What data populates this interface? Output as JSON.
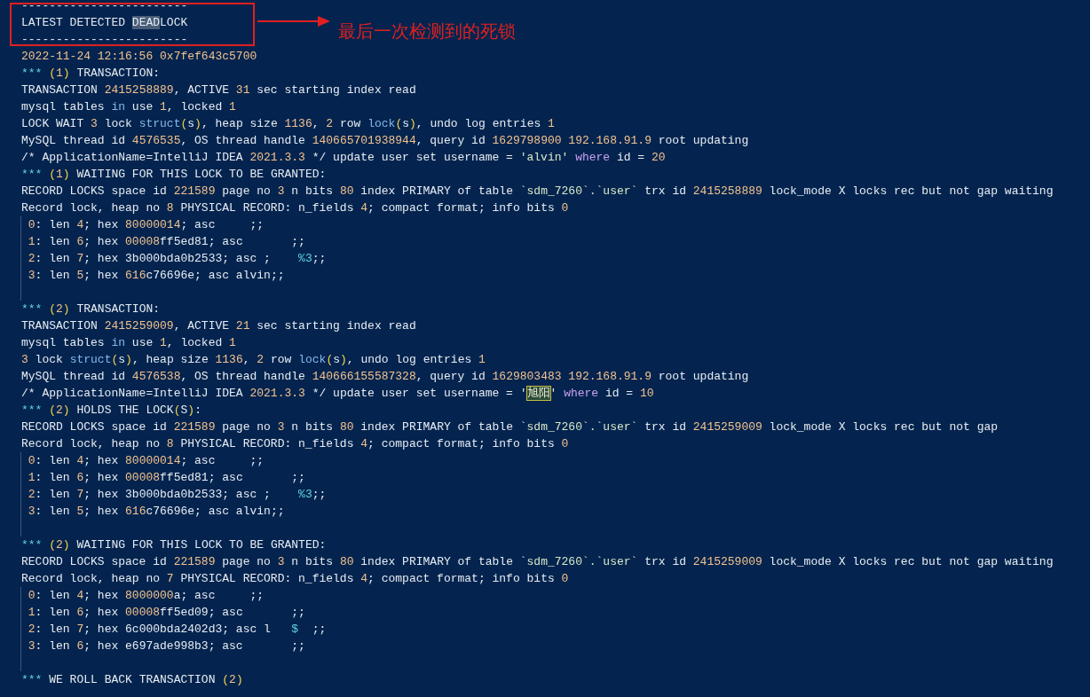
{
  "annotation": {
    "label": "最后一次检测到的死锁"
  },
  "lines": [
    {
      "kind": "code",
      "tokens": [
        {
          "text": "------------------------",
          "kind": "plain"
        }
      ]
    },
    {
      "kind": "code",
      "tokens": [
        {
          "text": "LATEST DETECTED ",
          "kind": "plain"
        },
        {
          "text": "DEAD",
          "kind": "mark"
        },
        {
          "text": "LOCK",
          "kind": "plain"
        }
      ]
    },
    {
      "kind": "code",
      "tokens": [
        {
          "text": "------------------------",
          "kind": "plain"
        }
      ]
    },
    {
      "kind": "code",
      "tokens": [
        {
          "text": "2022-11-24 12:16:56 0x7fef643c5700",
          "kind": "num"
        }
      ]
    },
    {
      "kind": "code",
      "tokens": [
        {
          "text": "*** ",
          "kind": "cyan"
        },
        {
          "text": "(",
          "kind": "paren"
        },
        {
          "text": "1",
          "kind": "num"
        },
        {
          "text": ")",
          "kind": "paren"
        },
        {
          "text": " TRANSACTION:",
          "kind": "plain"
        }
      ]
    },
    {
      "kind": "code",
      "tokens": [
        {
          "text": "TRANSACTION ",
          "kind": "plain"
        },
        {
          "text": "2415258889",
          "kind": "num"
        },
        {
          "text": ", ACTIVE ",
          "kind": "plain"
        },
        {
          "text": "31",
          "kind": "num"
        },
        {
          "text": " sec starting index read",
          "kind": "plain"
        }
      ]
    },
    {
      "kind": "code",
      "tokens": [
        {
          "text": "mysql tables ",
          "kind": "plain"
        },
        {
          "text": "in",
          "kind": "kw"
        },
        {
          "text": " use ",
          "kind": "plain"
        },
        {
          "text": "1",
          "kind": "num"
        },
        {
          "text": ", locked ",
          "kind": "plain"
        },
        {
          "text": "1",
          "kind": "num"
        }
      ]
    },
    {
      "kind": "code",
      "tokens": [
        {
          "text": "LOCK WAIT ",
          "kind": "plain"
        },
        {
          "text": "3",
          "kind": "num"
        },
        {
          "text": " lock ",
          "kind": "plain"
        },
        {
          "text": "struct",
          "kind": "kw"
        },
        {
          "text": "(",
          "kind": "paren"
        },
        {
          "text": "s",
          "kind": "plain"
        },
        {
          "text": ")",
          "kind": "paren"
        },
        {
          "text": ", heap size ",
          "kind": "plain"
        },
        {
          "text": "1136",
          "kind": "num"
        },
        {
          "text": ", ",
          "kind": "plain"
        },
        {
          "text": "2",
          "kind": "num"
        },
        {
          "text": " row ",
          "kind": "plain"
        },
        {
          "text": "lock",
          "kind": "kw"
        },
        {
          "text": "(",
          "kind": "paren"
        },
        {
          "text": "s",
          "kind": "plain"
        },
        {
          "text": ")",
          "kind": "paren"
        },
        {
          "text": ", undo log entries ",
          "kind": "plain"
        },
        {
          "text": "1",
          "kind": "num"
        }
      ]
    },
    {
      "kind": "code",
      "tokens": [
        {
          "text": "MySQL thread id ",
          "kind": "plain"
        },
        {
          "text": "4576535",
          "kind": "num"
        },
        {
          "text": ", OS thread handle ",
          "kind": "plain"
        },
        {
          "text": "140665701938944",
          "kind": "num"
        },
        {
          "text": ", query id ",
          "kind": "plain"
        },
        {
          "text": "1629798900 192.168.91.9",
          "kind": "num"
        },
        {
          "text": " root updating",
          "kind": "plain"
        }
      ]
    },
    {
      "kind": "code",
      "tokens": [
        {
          "text": "/* ApplicationName=IntelliJ IDEA ",
          "kind": "plain"
        },
        {
          "text": "2021.3.3",
          "kind": "num"
        },
        {
          "text": " */ update user set username = ",
          "kind": "plain"
        },
        {
          "text": "'alvin' ",
          "kind": "str"
        },
        {
          "text": "where",
          "kind": "purple"
        },
        {
          "text": " id = ",
          "kind": "plain"
        },
        {
          "text": "20",
          "kind": "num"
        }
      ]
    },
    {
      "kind": "code",
      "tokens": [
        {
          "text": "*** ",
          "kind": "cyan"
        },
        {
          "text": "(",
          "kind": "paren"
        },
        {
          "text": "1",
          "kind": "num"
        },
        {
          "text": ")",
          "kind": "paren"
        },
        {
          "text": " WAITING FOR THIS LOCK TO BE GRANTED:",
          "kind": "plain"
        }
      ]
    },
    {
      "kind": "code",
      "tokens": [
        {
          "text": "RECORD LOCKS space id ",
          "kind": "plain"
        },
        {
          "text": "221589",
          "kind": "num"
        },
        {
          "text": " page no ",
          "kind": "plain"
        },
        {
          "text": "3",
          "kind": "num"
        },
        {
          "text": " n bits ",
          "kind": "plain"
        },
        {
          "text": "80",
          "kind": "num"
        },
        {
          "text": " index PRIMARY of table ",
          "kind": "plain"
        },
        {
          "text": "`sdm_7260`.`user`",
          "kind": "str"
        },
        {
          "text": " trx id ",
          "kind": "plain"
        },
        {
          "text": "2415258889",
          "kind": "num"
        },
        {
          "text": " lock_mode X locks rec but not gap waiting",
          "kind": "plain"
        }
      ]
    },
    {
      "kind": "code",
      "tokens": [
        {
          "text": "Record lock, heap no ",
          "kind": "plain"
        },
        {
          "text": "8",
          "kind": "num"
        },
        {
          "text": " PHYSICAL RECORD: n_fields ",
          "kind": "plain"
        },
        {
          "text": "4",
          "kind": "num"
        },
        {
          "text": "; compact format; info bits ",
          "kind": "plain"
        },
        {
          "text": "0",
          "kind": "num"
        }
      ]
    },
    {
      "kind": "field",
      "tokens": [
        {
          "text": " 0",
          "kind": "num"
        },
        {
          "text": ": len ",
          "kind": "plain"
        },
        {
          "text": "4",
          "kind": "num"
        },
        {
          "text": "; hex ",
          "kind": "plain"
        },
        {
          "text": "80000014",
          "kind": "num"
        },
        {
          "text": "; asc     ;;",
          "kind": "plain"
        }
      ]
    },
    {
      "kind": "field",
      "tokens": [
        {
          "text": " 1",
          "kind": "num"
        },
        {
          "text": ": len ",
          "kind": "plain"
        },
        {
          "text": "6",
          "kind": "num"
        },
        {
          "text": "; hex ",
          "kind": "plain"
        },
        {
          "text": "00008",
          "kind": "num"
        },
        {
          "text": "ff5ed81; asc       ;;",
          "kind": "plain"
        }
      ]
    },
    {
      "kind": "field",
      "tokens": [
        {
          "text": " 2",
          "kind": "num"
        },
        {
          "text": ": len ",
          "kind": "plain"
        },
        {
          "text": "7",
          "kind": "num"
        },
        {
          "text": "; hex 3b000bda0b2533; asc ;    ",
          "kind": "plain"
        },
        {
          "text": "%3",
          "kind": "cyan"
        },
        {
          "text": ";;",
          "kind": "plain"
        }
      ]
    },
    {
      "kind": "field",
      "tokens": [
        {
          "text": " 3",
          "kind": "num"
        },
        {
          "text": ": len ",
          "kind": "plain"
        },
        {
          "text": "5",
          "kind": "num"
        },
        {
          "text": "; hex ",
          "kind": "plain"
        },
        {
          "text": "616",
          "kind": "num"
        },
        {
          "text": "c76696e; asc alvin;;",
          "kind": "plain"
        }
      ]
    },
    {
      "kind": "blank"
    },
    {
      "kind": "code",
      "tokens": [
        {
          "text": "*** ",
          "kind": "cyan"
        },
        {
          "text": "(",
          "kind": "paren"
        },
        {
          "text": "2",
          "kind": "num"
        },
        {
          "text": ")",
          "kind": "paren"
        },
        {
          "text": " TRANSACTION:",
          "kind": "plain"
        }
      ]
    },
    {
      "kind": "code",
      "tokens": [
        {
          "text": "TRANSACTION ",
          "kind": "plain"
        },
        {
          "text": "2415259009",
          "kind": "num"
        },
        {
          "text": ", ACTIVE ",
          "kind": "plain"
        },
        {
          "text": "21",
          "kind": "num"
        },
        {
          "text": " sec starting index read",
          "kind": "plain"
        }
      ]
    },
    {
      "kind": "code",
      "tokens": [
        {
          "text": "mysql tables ",
          "kind": "plain"
        },
        {
          "text": "in",
          "kind": "kw"
        },
        {
          "text": " use ",
          "kind": "plain"
        },
        {
          "text": "1",
          "kind": "num"
        },
        {
          "text": ", locked ",
          "kind": "plain"
        },
        {
          "text": "1",
          "kind": "num"
        }
      ]
    },
    {
      "kind": "code",
      "tokens": [
        {
          "text": "3",
          "kind": "num"
        },
        {
          "text": " lock ",
          "kind": "plain"
        },
        {
          "text": "struct",
          "kind": "kw"
        },
        {
          "text": "(",
          "kind": "paren"
        },
        {
          "text": "s",
          "kind": "plain"
        },
        {
          "text": ")",
          "kind": "paren"
        },
        {
          "text": ", heap size ",
          "kind": "plain"
        },
        {
          "text": "1136",
          "kind": "num"
        },
        {
          "text": ", ",
          "kind": "plain"
        },
        {
          "text": "2",
          "kind": "num"
        },
        {
          "text": " row ",
          "kind": "plain"
        },
        {
          "text": "lock",
          "kind": "kw"
        },
        {
          "text": "(",
          "kind": "paren"
        },
        {
          "text": "s",
          "kind": "plain"
        },
        {
          "text": ")",
          "kind": "paren"
        },
        {
          "text": ", undo log entries ",
          "kind": "plain"
        },
        {
          "text": "1",
          "kind": "num"
        }
      ]
    },
    {
      "kind": "code",
      "tokens": [
        {
          "text": "MySQL thread id ",
          "kind": "plain"
        },
        {
          "text": "4576538",
          "kind": "num"
        },
        {
          "text": ", OS thread handle ",
          "kind": "plain"
        },
        {
          "text": "140666155587328",
          "kind": "num"
        },
        {
          "text": ", query id ",
          "kind": "plain"
        },
        {
          "text": "1629803483 192.168.91.9",
          "kind": "num"
        },
        {
          "text": " root updating",
          "kind": "plain"
        }
      ]
    },
    {
      "kind": "code",
      "tokens": [
        {
          "text": "/* ApplicationName=IntelliJ IDEA ",
          "kind": "plain"
        },
        {
          "text": "2021.3.3",
          "kind": "num"
        },
        {
          "text": " */ update user set username = ",
          "kind": "plain"
        },
        {
          "text": "'",
          "kind": "str"
        },
        {
          "text": "旭阳",
          "kind": "boxed"
        },
        {
          "text": "' ",
          "kind": "str"
        },
        {
          "text": "where",
          "kind": "purple"
        },
        {
          "text": " id = ",
          "kind": "plain"
        },
        {
          "text": "10",
          "kind": "num"
        }
      ]
    },
    {
      "kind": "code",
      "tokens": [
        {
          "text": "*** ",
          "kind": "cyan"
        },
        {
          "text": "(",
          "kind": "paren"
        },
        {
          "text": "2",
          "kind": "num"
        },
        {
          "text": ")",
          "kind": "paren"
        },
        {
          "text": " HOLDS THE LOCK",
          "kind": "plain"
        },
        {
          "text": "(",
          "kind": "paren"
        },
        {
          "text": "S",
          "kind": "plain"
        },
        {
          "text": ")",
          "kind": "paren"
        },
        {
          "text": ":",
          "kind": "plain"
        }
      ]
    },
    {
      "kind": "code",
      "tokens": [
        {
          "text": "RECORD LOCKS space id ",
          "kind": "plain"
        },
        {
          "text": "221589",
          "kind": "num"
        },
        {
          "text": " page no ",
          "kind": "plain"
        },
        {
          "text": "3",
          "kind": "num"
        },
        {
          "text": " n bits ",
          "kind": "plain"
        },
        {
          "text": "80",
          "kind": "num"
        },
        {
          "text": " index PRIMARY of table ",
          "kind": "plain"
        },
        {
          "text": "`sdm_7260`.`user`",
          "kind": "str"
        },
        {
          "text": " trx id ",
          "kind": "plain"
        },
        {
          "text": "2415259009",
          "kind": "num"
        },
        {
          "text": " lock_mode X locks rec but not gap",
          "kind": "plain"
        }
      ]
    },
    {
      "kind": "code",
      "tokens": [
        {
          "text": "Record lock, heap no ",
          "kind": "plain"
        },
        {
          "text": "8",
          "kind": "num"
        },
        {
          "text": " PHYSICAL RECORD: n_fields ",
          "kind": "plain"
        },
        {
          "text": "4",
          "kind": "num"
        },
        {
          "text": "; compact format; info bits ",
          "kind": "plain"
        },
        {
          "text": "0",
          "kind": "num"
        }
      ]
    },
    {
      "kind": "field",
      "tokens": [
        {
          "text": " 0",
          "kind": "num"
        },
        {
          "text": ": len ",
          "kind": "plain"
        },
        {
          "text": "4",
          "kind": "num"
        },
        {
          "text": "; hex ",
          "kind": "plain"
        },
        {
          "text": "80000014",
          "kind": "num"
        },
        {
          "text": "; asc     ;;",
          "kind": "plain"
        }
      ]
    },
    {
      "kind": "field",
      "tokens": [
        {
          "text": " 1",
          "kind": "num"
        },
        {
          "text": ": len ",
          "kind": "plain"
        },
        {
          "text": "6",
          "kind": "num"
        },
        {
          "text": "; hex ",
          "kind": "plain"
        },
        {
          "text": "00008",
          "kind": "num"
        },
        {
          "text": "ff5ed81; asc       ;;",
          "kind": "plain"
        }
      ]
    },
    {
      "kind": "field",
      "tokens": [
        {
          "text": " 2",
          "kind": "num"
        },
        {
          "text": ": len ",
          "kind": "plain"
        },
        {
          "text": "7",
          "kind": "num"
        },
        {
          "text": "; hex 3b000bda0b2533; asc ;    ",
          "kind": "plain"
        },
        {
          "text": "%3",
          "kind": "cyan"
        },
        {
          "text": ";;",
          "kind": "plain"
        }
      ]
    },
    {
      "kind": "field",
      "tokens": [
        {
          "text": " 3",
          "kind": "num"
        },
        {
          "text": ": len ",
          "kind": "plain"
        },
        {
          "text": "5",
          "kind": "num"
        },
        {
          "text": "; hex ",
          "kind": "plain"
        },
        {
          "text": "616",
          "kind": "num"
        },
        {
          "text": "c76696e; asc alvin;;",
          "kind": "plain"
        }
      ]
    },
    {
      "kind": "blank"
    },
    {
      "kind": "code",
      "tokens": [
        {
          "text": "*** ",
          "kind": "cyan"
        },
        {
          "text": "(",
          "kind": "paren"
        },
        {
          "text": "2",
          "kind": "num"
        },
        {
          "text": ")",
          "kind": "paren"
        },
        {
          "text": " WAITING FOR THIS LOCK TO BE GRANTED:",
          "kind": "plain"
        }
      ]
    },
    {
      "kind": "code",
      "tokens": [
        {
          "text": "RECORD LOCKS space id ",
          "kind": "plain"
        },
        {
          "text": "221589",
          "kind": "num"
        },
        {
          "text": " page no ",
          "kind": "plain"
        },
        {
          "text": "3",
          "kind": "num"
        },
        {
          "text": " n bits ",
          "kind": "plain"
        },
        {
          "text": "80",
          "kind": "num"
        },
        {
          "text": " index PRIMARY of table ",
          "kind": "plain"
        },
        {
          "text": "`sdm_7260`.`user`",
          "kind": "str"
        },
        {
          "text": " trx id ",
          "kind": "plain"
        },
        {
          "text": "2415259009",
          "kind": "num"
        },
        {
          "text": " lock_mode X locks rec but not gap waiting",
          "kind": "plain"
        }
      ]
    },
    {
      "kind": "code",
      "tokens": [
        {
          "text": "Record lock, heap no ",
          "kind": "plain"
        },
        {
          "text": "7",
          "kind": "num"
        },
        {
          "text": " PHYSICAL RECORD: n_fields ",
          "kind": "plain"
        },
        {
          "text": "4",
          "kind": "num"
        },
        {
          "text": "; compact format; info bits ",
          "kind": "plain"
        },
        {
          "text": "0",
          "kind": "num"
        }
      ]
    },
    {
      "kind": "field",
      "tokens": [
        {
          "text": " 0",
          "kind": "num"
        },
        {
          "text": ": len ",
          "kind": "plain"
        },
        {
          "text": "4",
          "kind": "num"
        },
        {
          "text": "; hex ",
          "kind": "plain"
        },
        {
          "text": "8000000",
          "kind": "num"
        },
        {
          "text": "a; asc     ;;",
          "kind": "plain"
        }
      ]
    },
    {
      "kind": "field",
      "tokens": [
        {
          "text": " 1",
          "kind": "num"
        },
        {
          "text": ": len ",
          "kind": "plain"
        },
        {
          "text": "6",
          "kind": "num"
        },
        {
          "text": "; hex ",
          "kind": "plain"
        },
        {
          "text": "00008",
          "kind": "num"
        },
        {
          "text": "ff5ed09; asc       ;;",
          "kind": "plain"
        }
      ]
    },
    {
      "kind": "field",
      "tokens": [
        {
          "text": " 2",
          "kind": "num"
        },
        {
          "text": ": len ",
          "kind": "plain"
        },
        {
          "text": "7",
          "kind": "num"
        },
        {
          "text": "; hex 6c000bda2402d3; asc l   ",
          "kind": "plain"
        },
        {
          "text": "$  ",
          "kind": "cyan"
        },
        {
          "text": ";;",
          "kind": "plain"
        }
      ]
    },
    {
      "kind": "field",
      "tokens": [
        {
          "text": " 3",
          "kind": "num"
        },
        {
          "text": ": len ",
          "kind": "plain"
        },
        {
          "text": "6",
          "kind": "num"
        },
        {
          "text": "; hex e697ade998b3; asc       ;;",
          "kind": "plain"
        }
      ]
    },
    {
      "kind": "blank"
    },
    {
      "kind": "code",
      "tokens": [
        {
          "text": "*** ",
          "kind": "cyan"
        },
        {
          "text": "WE ROLL BACK TRANSACTION ",
          "kind": "plain"
        },
        {
          "text": "(",
          "kind": "paren"
        },
        {
          "text": "2",
          "kind": "num"
        },
        {
          "text": ")",
          "kind": "paren"
        }
      ]
    }
  ]
}
